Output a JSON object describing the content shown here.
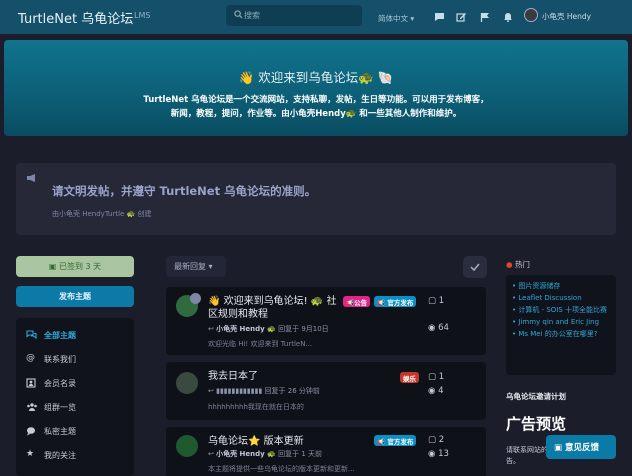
{
  "header": {
    "logo": "TurtleNet 乌龟论坛",
    "lms": "LMS",
    "search_placeholder": "搜索",
    "language": "简体中文",
    "user": "小龟壳 Hendy"
  },
  "hero": {
    "title": "👋 欢迎来到乌龟论坛🐢 🐚",
    "line1": "TurtleNet 乌龟论坛是一个交流网站，支持私聊，发帖，生日等功能。可以用于发布博客，",
    "line2": "新闻，教程，提问，作业等。由小龟壳Hendy🐢 和一些其他人制作和维护。"
  },
  "announcement": {
    "text": "请文明发帖，并遵守 TurtleNet 乌龟论坛的准则。",
    "by": "由小龟壳 HendyTurtle 🐢 创建"
  },
  "sidebar": {
    "signed": "已签到 3 天",
    "post_button": "发布主题",
    "nav": [
      {
        "label": "全部主题",
        "icon": "chat-bubbles-icon",
        "active": true
      },
      {
        "label": "联系我们",
        "icon": "at-sign-icon",
        "active": false
      },
      {
        "label": "会员名录",
        "icon": "member-list-icon",
        "active": false
      },
      {
        "label": "组群一览",
        "icon": "groups-icon",
        "active": false
      },
      {
        "label": "私密主题",
        "icon": "private-chat-icon",
        "active": false
      },
      {
        "label": "我的关注",
        "icon": "star-icon",
        "active": false
      }
    ]
  },
  "toolbar": {
    "sort": "最新回复 ▾"
  },
  "topics": [
    {
      "title_line1": "👋 欢迎来到乌龟论坛! 🐢 社",
      "title_line2": "区规则和教程",
      "author": "小龟壳 Hendy 🐢",
      "reply_time": "回复于 9月10日",
      "excerpt": "欢迎光临 Hi! 欢迎来到 TurtleN...",
      "tags": [
        "📢公告",
        "📢 官方发布"
      ],
      "replies": "1",
      "views": "64"
    },
    {
      "title_line1": "我去日本了",
      "author": "",
      "reply_time": "回复于 26 分钟前",
      "excerpt": "hhhhhhhhh我现在就在日本的",
      "tags": [
        "娱乐"
      ],
      "replies": "1",
      "views": "4"
    },
    {
      "title_line1": "乌龟论坛⭐ 版本更新",
      "author": "小龟壳 Hendy 🐢",
      "reply_time": "回复于 1 天前",
      "excerpt": "本主题将提供一些乌龟论坛的版本更新和更新...",
      "tags": [
        "📢 官方发布"
      ],
      "replies": "2",
      "views": "13"
    }
  ],
  "right": {
    "hot_title": "热门",
    "hot_items": [
      "图片资源储存",
      "Leaflet Discussion",
      "计算机 - SOIS 十项全能比赛",
      "Jimmy qin and Eric Jing",
      "Ms Mei 的办公室在哪里?"
    ],
    "invite": "乌龟论坛邀请计划",
    "ad_title": "广告预览",
    "ad_text": "请联系网站的广告。",
    "feedback": "意见反馈"
  },
  "colors": {
    "header": "#14506a",
    "accent": "#0b7aa6",
    "link": "#2ea8d8",
    "background": "#1b1d2b",
    "tag_announce": "#e0258a",
    "tag_official": "#0b8fc4",
    "tag_fun": "#c0392b"
  }
}
